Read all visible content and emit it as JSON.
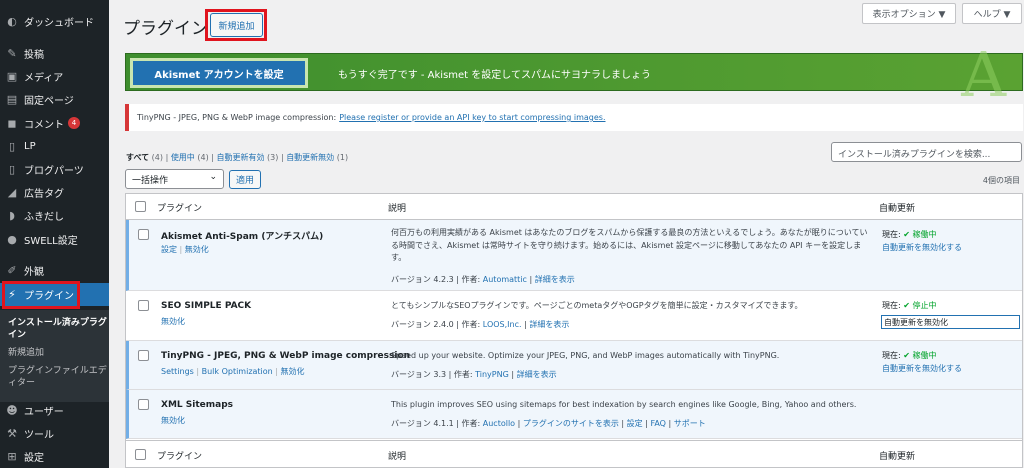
{
  "sidebar": {
    "dashboard": "ダッシュボード",
    "posts": "投稿",
    "media": "メディア",
    "pages": "固定ページ",
    "comments": "コメント",
    "comments_badge": "4",
    "lp": "LP",
    "blog_parts": "ブログパーツ",
    "ad_tags": "広告タグ",
    "balloons": "ふきだし",
    "swell": "SWELL設定",
    "appearance": "外観",
    "plugins": "プラグイン",
    "sub_installed": "インストール済みプラグイン",
    "sub_add_new": "新規追加",
    "sub_editor": "プラグインファイルエディター",
    "users": "ユーザー",
    "tools": "ツール",
    "settings": "設定"
  },
  "header": {
    "title": "プラグイン",
    "add_new": "新規追加",
    "screen_options": "表示オプション ▼",
    "help": "ヘルプ ▼"
  },
  "akismet": {
    "button": "Akismet アカウントを設定",
    "text": "もうすぐ完了です - Akismet を設定してスパムにサヨナラしましょう",
    "logo": "A"
  },
  "notice": {
    "text": "TinyPNG - JPEG, PNG & WebP image compression:",
    "link": "Please register or provide an API key to start compressing images."
  },
  "filters": {
    "all": "すべて",
    "all_count": "(4)",
    "active": "使用中",
    "active_count": "(4)",
    "auto_on": "自動更新有効",
    "auto_on_count": "(3)",
    "auto_off": "自動更新無効",
    "auto_off_count": "(1)",
    "sep": "|"
  },
  "search": {
    "placeholder": "インストール済みプラグインを検索..."
  },
  "bulk": {
    "label": "一括操作",
    "apply": "適用",
    "count": "4個の項目"
  },
  "table": {
    "col_plugin": "プラグイン",
    "col_desc": "説明",
    "col_auto": "自動更新"
  },
  "plugins": [
    {
      "name": "Akismet Anti-Spam (アンチスパム)",
      "actions": [
        "設定",
        "無効化"
      ],
      "desc": "何百万もの利用実績がある Akismet はあなたのブログをスパムから保護する最良の方法といえるでしょう。あなたが眠りについている時間でさえ、Akismet は常時サイトを守り続けます。始めるには、Akismet 設定ページに移動してあなたの API キーを設定します。",
      "version": "バージョン 4.2.3 | 作者: ",
      "author": "Automattic",
      "details": "詳細を表示",
      "status": "現在: ",
      "status_value": "✔ 稼働中",
      "auto_action": "自動更新を無効化する"
    },
    {
      "name": "SEO SIMPLE PACK",
      "actions": [
        "無効化"
      ],
      "desc": "とてもシンプルなSEOプラグインです。ページごとのmetaタグやOGPタグを簡単に設定・カスタマイズできます。",
      "version": "バージョン 2.4.0 | 作者: ",
      "author": "LOOS,Inc.",
      "details": "詳細を表示",
      "status": "現在: ",
      "status_value": "✔ 停止中",
      "auto_action": "自動更新を無効化"
    },
    {
      "name": "TinyPNG - JPEG, PNG & WebP image compression",
      "actions": [
        "Settings",
        "Bulk Optimization",
        "無効化"
      ],
      "desc": "Speed up your website. Optimize your JPEG, PNG, and WebP images automatically with TinyPNG.",
      "version": "バージョン 3.3 | 作者: ",
      "author": "TinyPNG",
      "details": "詳細を表示",
      "status": "現在: ",
      "status_value": "✔ 稼働中",
      "auto_action": "自動更新を無効化する"
    },
    {
      "name": "XML Sitemaps",
      "actions": [
        "無効化"
      ],
      "desc": "This plugin improves SEO using sitemaps for best indexation by search engines like Google, Bing, Yahoo and others.",
      "version": "バージョン 4.1.1 | 作者: ",
      "author": "Auctollo",
      "details": "プラグインのサイトを表示",
      "settings": "設定",
      "faq": "FAQ",
      "support": "サポート"
    }
  ],
  "sep": "|"
}
